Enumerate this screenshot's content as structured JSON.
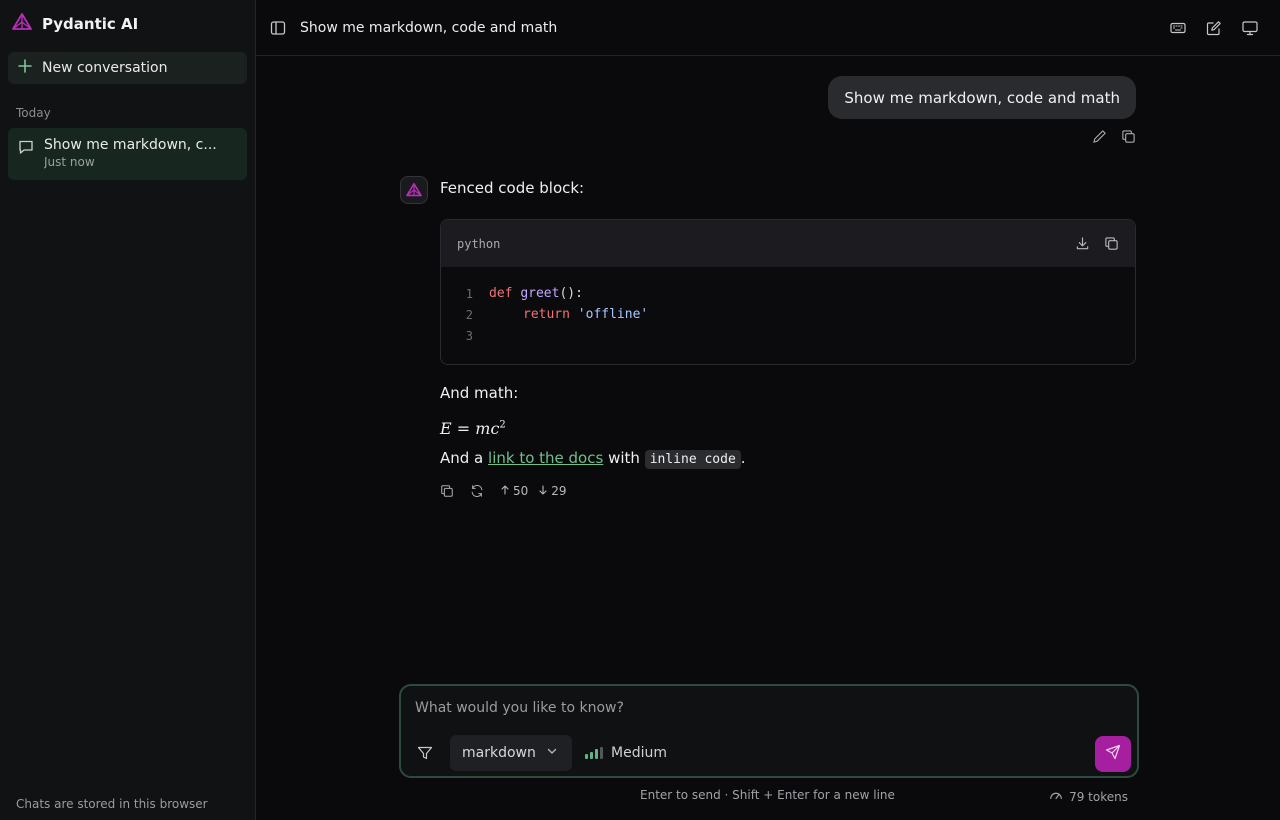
{
  "app": {
    "name": "Pydantic AI",
    "brand_color": "#b72fb6",
    "accent_color": "#2e4a3c"
  },
  "sidebar": {
    "new_conversation_label": "New conversation",
    "section_label": "Today",
    "conversations": [
      {
        "title": "Show me markdown, c...",
        "subtitle": "Just now",
        "icon": "chat-bubble-icon"
      }
    ],
    "footer": "Chats are stored in this browser"
  },
  "header": {
    "title": "Show me markdown, code and math",
    "icons": [
      "sidebar-toggle-icon",
      "keyboard-icon",
      "edit-icon",
      "monitor-icon"
    ]
  },
  "user_message": {
    "text": "Show me markdown, code and math"
  },
  "assistant_message": {
    "intro": "Fenced code block:",
    "code": {
      "language": "python",
      "line_numbers": [
        "1",
        "2",
        "3"
      ],
      "line1": {
        "kw": "def",
        "fn": "greet",
        "punct": "():"
      },
      "line2": {
        "kw": "return",
        "str": "'offline'"
      }
    },
    "math_intro": "And math:",
    "math": {
      "lhs": "E",
      "eq": " = ",
      "var": "mc",
      "exp": "2"
    },
    "final": {
      "prefix": "And a ",
      "link": "link to the docs",
      "middle": " with ",
      "code": "inline code",
      "suffix": "."
    },
    "stats": {
      "input_tokens": "50",
      "output_tokens": "29"
    }
  },
  "composer": {
    "placeholder": "What would you like to know?",
    "model": "markdown",
    "effort": "Medium",
    "hint": "Enter to send · Shift + Enter for a new line",
    "tokens": "79 tokens"
  }
}
